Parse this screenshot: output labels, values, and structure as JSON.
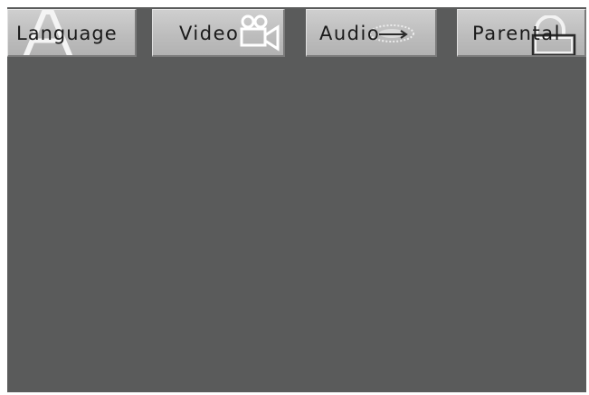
{
  "tabs": [
    {
      "label": "Language",
      "icon": "language-a-icon"
    },
    {
      "label": "Video",
      "icon": "video-camera-icon"
    },
    {
      "label": "Audio",
      "icon": "audio-speaker-icon"
    },
    {
      "label": "Parental",
      "icon": "parental-lock-icon"
    }
  ],
  "colors": {
    "background": "#5a5b5b",
    "tab_face": "#c4c4c4",
    "text": "#1a1a1a"
  }
}
